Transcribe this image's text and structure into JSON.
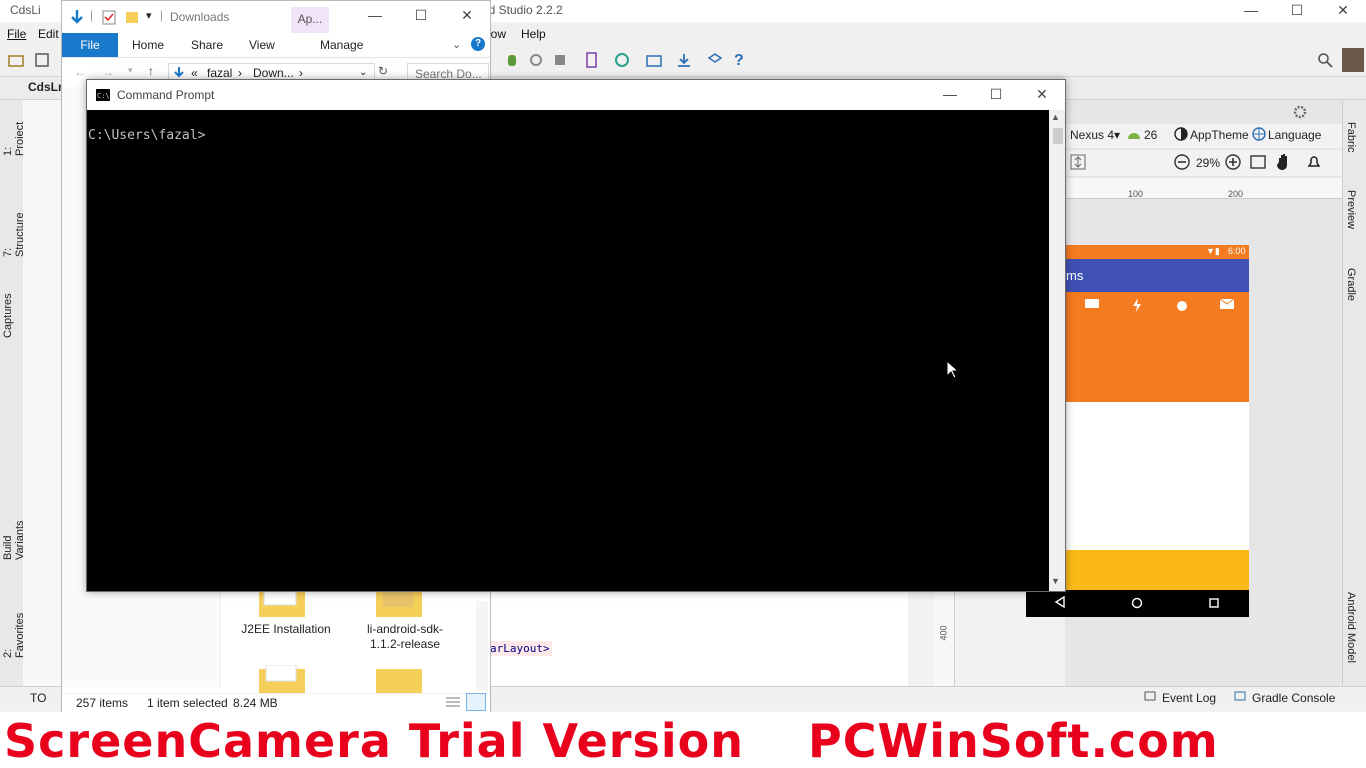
{
  "android_studio": {
    "title_left": "CdsLi",
    "title_right": "id Studio 2.2.2",
    "menu": {
      "file": "File",
      "edit": "Edit",
      "window": "low",
      "help": "Help"
    },
    "nav_project": "CdsLm",
    "left_tabs": [
      "1: Project",
      "7: Structure",
      "Captures",
      "Build Variants",
      "2: Favorites"
    ],
    "right_tabs": [
      "Fabric",
      "Preview",
      "Gradle",
      "Android Model"
    ],
    "code_tag": "arLayout>",
    "designer": {
      "device": "Nexus 4",
      "api": "26",
      "theme": "AppTheme",
      "language": "Language",
      "zoom": "29%",
      "ruler_100": "100",
      "ruler_200": "200",
      "ruler_400": "400",
      "status_time": "6:00",
      "appbar_text": "ms"
    },
    "bottom": {
      "todo": "TO",
      "event_log": "Event Log",
      "gradle_console": "Gradle Console"
    }
  },
  "explorer": {
    "title": "Downloads",
    "contextual_tab": "Ap...",
    "tabs": {
      "file": "File",
      "home": "Home",
      "share": "Share",
      "view": "View",
      "manage": "Manage"
    },
    "address": {
      "prefix": "«",
      "part1": "fazal",
      "sep": "›",
      "part2": "Down...",
      "sep2": "›"
    },
    "search_placeholder": "Search Do...",
    "folders": [
      {
        "label": "J2EE Installation"
      },
      {
        "label": "li-android-sdk-1.1.2-release"
      }
    ],
    "status": {
      "items": "257 items",
      "selected": "1 item selected",
      "size": "8.24 MB"
    }
  },
  "cmd": {
    "title": "Command Prompt",
    "prompt": "C:\\Users\\fazal>"
  },
  "watermark": {
    "left": "ScreenCamera Trial Version",
    "right": "PCWinSoft.com"
  },
  "colors": {
    "accent_blue": "#1979ca",
    "phone_orange": "#f47b20",
    "phone_indigo": "#3f51b5",
    "phone_yellow": "#fbb917",
    "watermark_red": "#e8001c"
  }
}
